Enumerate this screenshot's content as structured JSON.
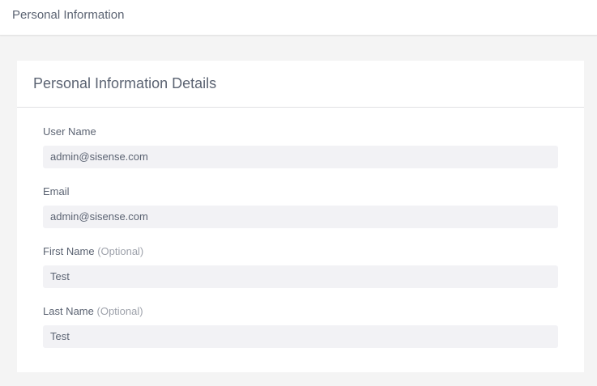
{
  "topbar": {
    "title": "Personal Information"
  },
  "card": {
    "title": "Personal Information Details"
  },
  "fields": [
    {
      "label": "User Name",
      "optional": "",
      "value": "admin@sisense.com"
    },
    {
      "label": "Email",
      "optional": "",
      "value": "admin@sisense.com"
    },
    {
      "label": "First Name",
      "optional": "(Optional)",
      "value": "Test"
    },
    {
      "label": "Last Name",
      "optional": "(Optional)",
      "value": "Test"
    }
  ]
}
